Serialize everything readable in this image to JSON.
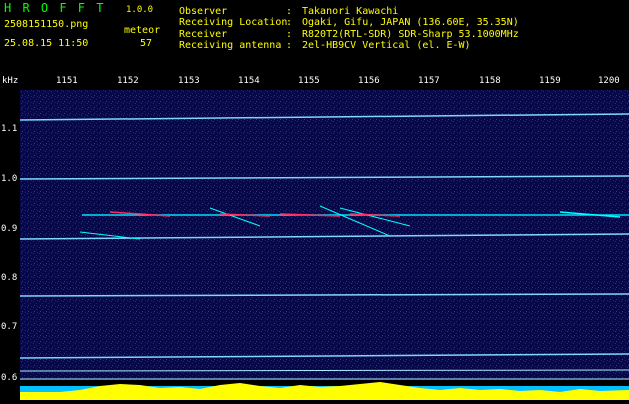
{
  "header": {
    "app_title": "H R O F F T",
    "app_version": "1.0.0",
    "file_name": "2508151150.png",
    "timestamp": "25.08.15 11:50",
    "meteor_label": "meteor",
    "meteor_count": "57",
    "info": [
      {
        "key": "Observer",
        "sep": ":",
        "value": "Takanori Kawachi"
      },
      {
        "key": "Receiving Location",
        "sep": ":",
        "value": "Ogaki, Gifu, JAPAN (136.60E, 35.35N)"
      },
      {
        "key": "Receiver",
        "sep": ":",
        "value": "R820T2(RTL-SDR) SDR-Sharp 53.1000MHz"
      },
      {
        "key": "Receiving antenna",
        "sep": ":",
        "value": "2el-HB9CV Vertical (el. E-W)"
      }
    ]
  },
  "spectrogram": {
    "x_unit": "kHz",
    "x_ticks": [
      "1151",
      "1152",
      "1153",
      "1154",
      "1155",
      "1156",
      "1157",
      "1158",
      "1159",
      "1200"
    ],
    "y_ticks": [
      "1.1",
      "1.0",
      "0.9",
      "0.8",
      "0.7",
      "0.6"
    ],
    "colors": {
      "background": "#06084a",
      "carrier_line": "#7fd7ff",
      "meteor_trace": "#00ffff",
      "meteor_hot": "#ff3060",
      "bottom_bar": "#00c0ff",
      "activity": "#ffff00"
    }
  }
}
